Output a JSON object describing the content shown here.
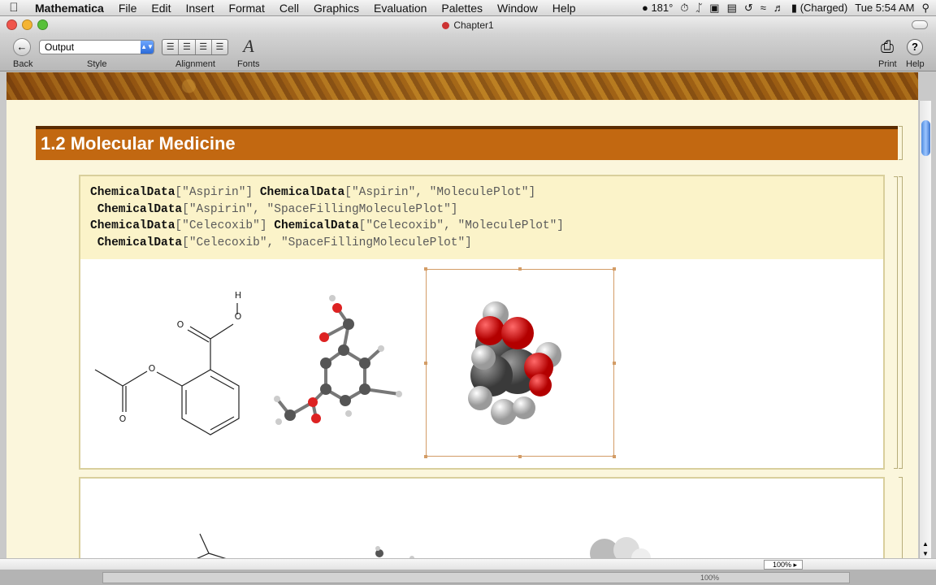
{
  "menubar": {
    "app_name": "Mathematica",
    "items": [
      "File",
      "Edit",
      "Insert",
      "Format",
      "Cell",
      "Graphics",
      "Evaluation",
      "Palettes",
      "Window",
      "Help"
    ],
    "status": {
      "temperature": "181°",
      "battery": "(Charged)",
      "clock": "Tue 5:54 AM"
    }
  },
  "window": {
    "title": "Chapter1"
  },
  "toolbar": {
    "back_label": "Back",
    "style_label": "Style",
    "style_value": "Output",
    "alignment_label": "Alignment",
    "fonts_label": "Fonts",
    "print_label": "Print",
    "help_label": "Help"
  },
  "section": {
    "title": "1.2 Molecular Medicine"
  },
  "input_cell": {
    "lines": [
      {
        "parts": [
          {
            "b": "ChemicalData"
          },
          {
            "t": "[\"Aspirin\"] "
          },
          {
            "b": "ChemicalData"
          },
          {
            "t": "[\"Aspirin\", \"MoleculePlot\"]"
          }
        ]
      },
      {
        "parts": [
          {
            "t": " "
          },
          {
            "b": "ChemicalData"
          },
          {
            "t": "[\"Aspirin\", \"SpaceFillingMoleculePlot\"]"
          }
        ]
      },
      {
        "parts": [
          {
            "b": "ChemicalData"
          },
          {
            "t": "[\"Celecoxib\"] "
          },
          {
            "b": "ChemicalData"
          },
          {
            "t": "[\"Celecoxib\", \"MoleculePlot\"]"
          }
        ]
      },
      {
        "parts": [
          {
            "t": " "
          },
          {
            "b": "ChemicalData"
          },
          {
            "t": "[\"Celecoxib\", \"SpaceFillingMoleculePlot\"]"
          }
        ]
      }
    ]
  },
  "structure_atoms": {
    "h": "H",
    "o1": "O",
    "o2": "O",
    "o3": "O",
    "o4": "O"
  },
  "zoom": {
    "value": "100%",
    "bottom_value": "100%"
  },
  "colors": {
    "section_bg": "#c26811",
    "cell_bg": "#fbf6dc",
    "selection": "#d39c66"
  }
}
